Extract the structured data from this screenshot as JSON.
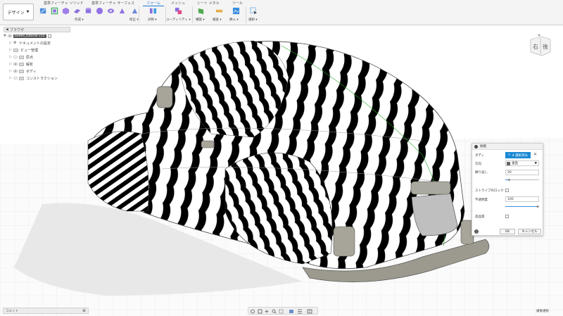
{
  "toolbar": {
    "workspace_button": "デザイン",
    "tabs": [
      {
        "label": "基準フィーチャ ソリッド",
        "active": false
      },
      {
        "label": "基準フィーチャ サーフェス",
        "active": false
      },
      {
        "label": "フォーム",
        "active": true
      },
      {
        "label": "メッシュ",
        "active": false
      },
      {
        "label": "シート メタル",
        "active": false
      },
      {
        "label": "ツール",
        "active": false
      }
    ],
    "groups": [
      {
        "label": "作成 ▾"
      },
      {
        "label": "修正 ▾"
      },
      {
        "label": "対称 ▾"
      },
      {
        "label": "ユーティリティ ▾"
      },
      {
        "label": "構築 ▾"
      },
      {
        "label": "検査 ▾"
      },
      {
        "label": "挿入 ▾"
      },
      {
        "label": "選択 ▾"
      }
    ]
  },
  "browser": {
    "title": "ブラウザ",
    "root": "beetle_tutorial v15",
    "items": [
      {
        "label": "ドキュメントの設定"
      },
      {
        "label": "ビュー管理"
      },
      {
        "label": "原点"
      },
      {
        "label": "解析"
      },
      {
        "label": "ボディ"
      },
      {
        "label": "コンストラクション"
      }
    ]
  },
  "viewcube": {
    "front": "右",
    "side": "後"
  },
  "panel": {
    "title": "縞模",
    "body_label": "ボディ",
    "body_value": "4 選択済み",
    "direction_label": "方向",
    "direction_value": "垂直",
    "repeat_label": "繰り返し",
    "repeat_value": "20",
    "repeat_level": 0.12,
    "stripe_lock_label": "ストライプのロック",
    "opacity_label": "不透明度",
    "opacity_value": "100",
    "opacity_level": 1.0,
    "hq_label": "高品質",
    "ok": "OK",
    "cancel": "キャンセル"
  },
  "status": {
    "comments": "コメント",
    "multi_select": "複数選択"
  }
}
